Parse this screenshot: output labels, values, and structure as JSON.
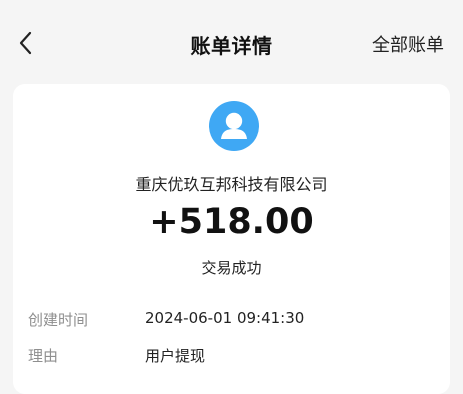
{
  "header": {
    "title": "账单详情",
    "right_link": "全部账单",
    "back_icon": "chevron-left-icon"
  },
  "transaction": {
    "avatar_icon": "user-avatar-icon",
    "avatar_color": "#3fa8f4",
    "merchant": "重庆优玖互邦科技有限公司",
    "amount": "+518.00",
    "status": "交易成功"
  },
  "details": [
    {
      "label": "创建时间",
      "value": "2024-06-01 09:41:30"
    },
    {
      "label": "理由",
      "value": "用户提现"
    }
  ]
}
